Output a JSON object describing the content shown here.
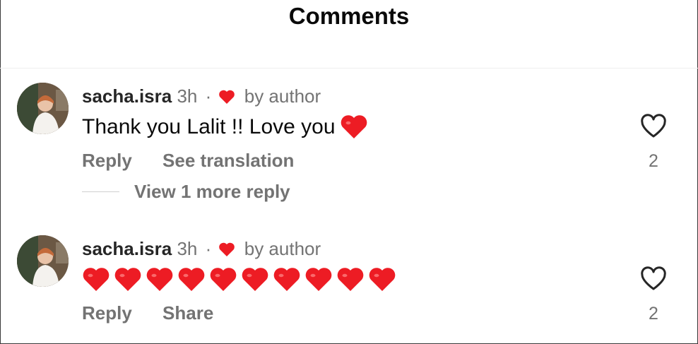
{
  "header": {
    "title": "Comments"
  },
  "comments": [
    {
      "username": "sacha.isra",
      "time": "3h",
      "separator": "·",
      "author_tag": "by author",
      "text": "Thank you Lalit !! Love you",
      "actions": [
        "Reply",
        "See translation"
      ],
      "like_count": "2",
      "view_more": "View 1 more reply"
    },
    {
      "username": "sacha.isra",
      "time": "3h",
      "separator": "·",
      "author_tag": "by author",
      "heart_emoji_count": 10,
      "actions": [
        "Reply",
        "Share"
      ],
      "like_count": "2"
    }
  ],
  "colors": {
    "heart_red": "#ed1c24",
    "secondary_text": "#737373",
    "primary_text": "#0a0a0a"
  },
  "icons": {
    "like": "heart-outline-icon",
    "author_liked": "heart-filled-icon",
    "emoji": "red-heart-emoji"
  }
}
